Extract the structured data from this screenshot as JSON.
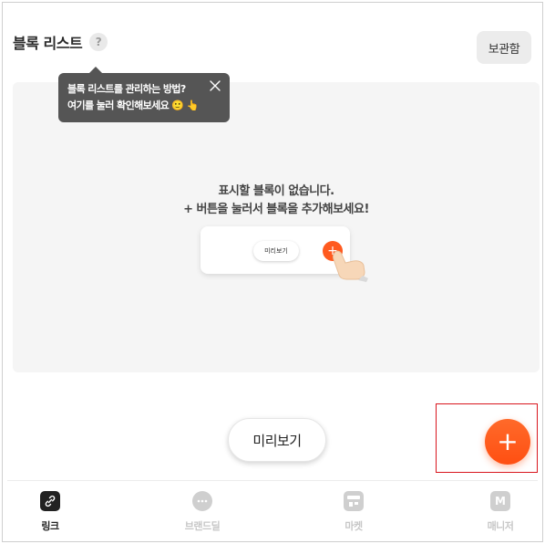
{
  "header": {
    "title": "블록 리스트",
    "help": "?",
    "storage_label": "보관함"
  },
  "tooltip": {
    "line1": "블록 리스트를 관리하는 방법?",
    "line2": "여기를 눌러 확인해보세요 🙂 👆"
  },
  "empty_state": {
    "title": "표시할 블록이 없습니다.",
    "subtitle": "+ 버튼을 눌러서 블록을 추가해보세요!",
    "illustration_preview": "미리보기",
    "illustration_plus": "+"
  },
  "actions": {
    "preview_label": "미리보기",
    "add_symbol": "+"
  },
  "colors": {
    "accent": "#ff5a1f",
    "highlight_border": "#d9161e"
  },
  "nav": {
    "items": [
      {
        "label": "링크",
        "icon": "link-icon",
        "active": true
      },
      {
        "label": "브랜드딜",
        "icon": "chat-bubble-icon",
        "active": false
      },
      {
        "label": "마켓",
        "icon": "store-icon",
        "active": false
      },
      {
        "label": "매니저",
        "icon": "manager-m-icon",
        "glyph": "M",
        "active": false
      }
    ]
  }
}
